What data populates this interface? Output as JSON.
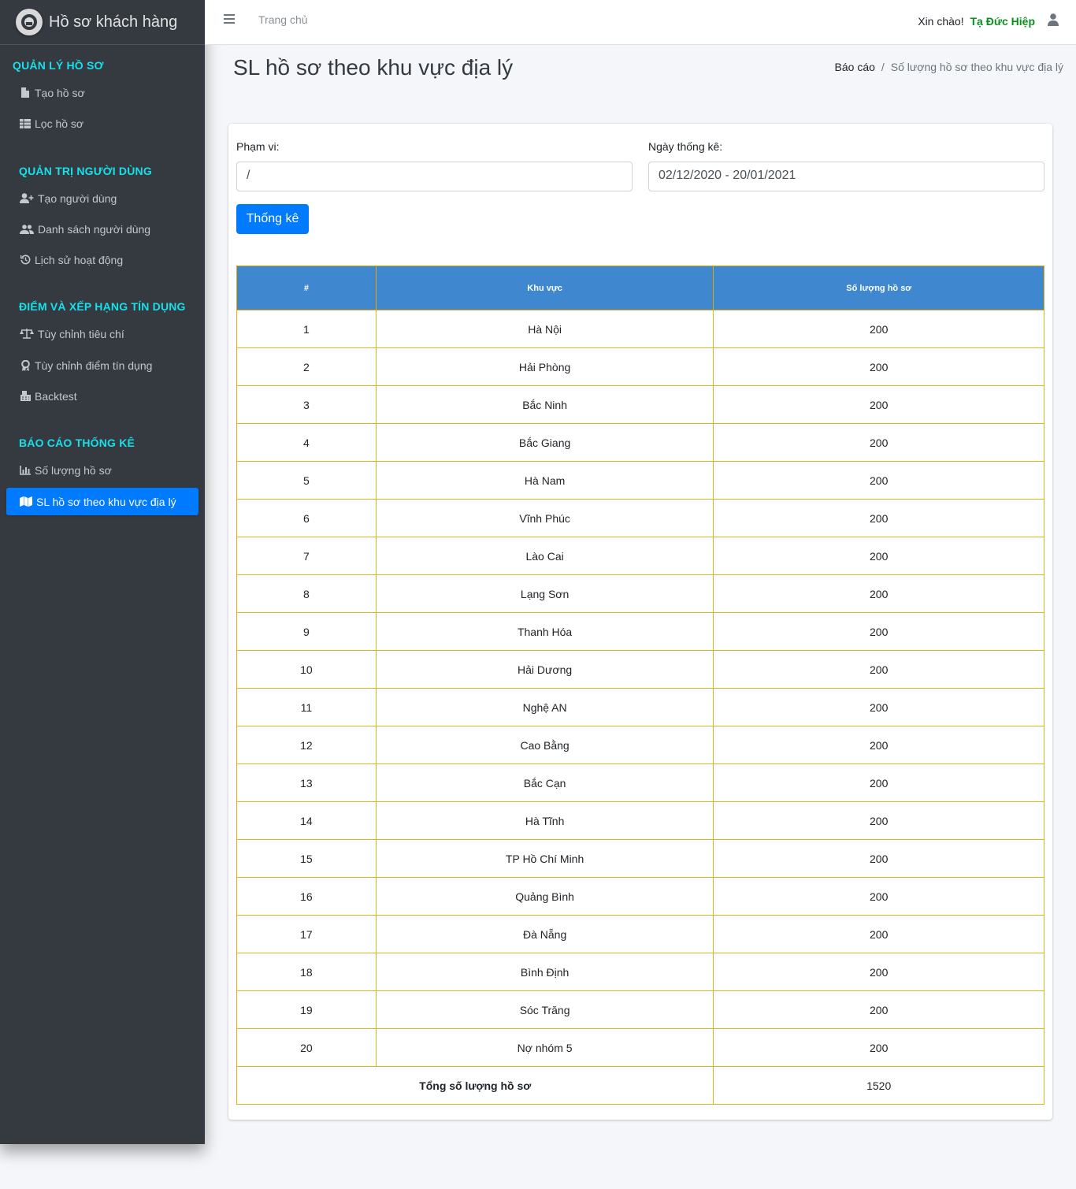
{
  "brand": {
    "title": "Hồ sơ khách hàng"
  },
  "topbar": {
    "home": "Trang chủ",
    "greeting": "Xin chào!",
    "user_name": "Tạ Đức Hiệp"
  },
  "sidebar": {
    "sections": [
      {
        "header": "QUẢN LÝ HỒ SƠ",
        "items": [
          {
            "label": "Tạo hồ sơ",
            "icon": "file-icon"
          },
          {
            "label": "Lọc hồ sơ",
            "icon": "table-icon"
          }
        ]
      },
      {
        "header": "QUẢN TRỊ NGƯỜI DÙNG",
        "items": [
          {
            "label": "Tạo người dùng",
            "icon": "user-plus-icon"
          },
          {
            "label": "Danh sách người dùng",
            "icon": "users-icon"
          },
          {
            "label": "Lịch sử hoạt động",
            "icon": "history-icon"
          }
        ]
      },
      {
        "header": "ĐIỂM VÀ XẾP HẠNG TÍN DỤNG",
        "items": [
          {
            "label": "Tùy chỉnh tiêu chí",
            "icon": "balance-scale-icon"
          },
          {
            "label": "Tùy chỉnh điểm tín dụng",
            "icon": "award-icon"
          },
          {
            "label": "Backtest",
            "icon": "calculator-icon"
          }
        ]
      },
      {
        "header": "BÁO CÁO THỐNG KÊ",
        "items": [
          {
            "label": "Số lượng hồ sơ",
            "icon": "chart-bar-icon"
          },
          {
            "label": "SL hồ sơ theo khu vực địa lý",
            "icon": "map-icon",
            "active": true
          }
        ]
      }
    ]
  },
  "page": {
    "title": "SL hồ sơ theo khu vực địa lý",
    "breadcrumb": {
      "parent": "Báo cáo",
      "separator": "/",
      "current": "Số lượng hồ sơ theo khu vực địa lý"
    }
  },
  "form": {
    "scope_label": "Phạm vi:",
    "scope_value": "/",
    "date_label": "Ngày thống kê:",
    "date_value": "02/12/2020 - 20/01/2021",
    "submit_label": "Thống kê"
  },
  "table": {
    "headers": [
      "#",
      "Khu vực",
      "Số lượng hồ sơ"
    ],
    "rows": [
      [
        "1",
        "Hà Nội",
        "200"
      ],
      [
        "2",
        "Hải Phòng",
        "200"
      ],
      [
        "3",
        "Bắc Ninh",
        "200"
      ],
      [
        "4",
        "Bắc Giang",
        "200"
      ],
      [
        "5",
        "Hà Nam",
        "200"
      ],
      [
        "6",
        "Vĩnh Phúc",
        "200"
      ],
      [
        "7",
        "Lào Cai",
        "200"
      ],
      [
        "8",
        "Lạng Sơn",
        "200"
      ],
      [
        "9",
        "Thanh Hóa",
        "200"
      ],
      [
        "10",
        "Hải Dương",
        "200"
      ],
      [
        "11",
        "Nghệ AN",
        "200"
      ],
      [
        "12",
        "Cao Bằng",
        "200"
      ],
      [
        "13",
        "Bắc Cạn",
        "200"
      ],
      [
        "14",
        "Hà Tĩnh",
        "200"
      ],
      [
        "15",
        "TP Hồ Chí Minh",
        "200"
      ],
      [
        "16",
        "Quảng Bình",
        "200"
      ],
      [
        "17",
        "Đà Nẵng",
        "200"
      ],
      [
        "18",
        "Bình Định",
        "200"
      ],
      [
        "19",
        "Sóc Trăng",
        "200"
      ],
      [
        "20",
        "Nợ nhóm 5",
        "200"
      ]
    ],
    "total_label": "Tổng số lượng hồ sơ",
    "total_value": "1520"
  },
  "colors": {
    "sidebar_bg": "#343a40",
    "accent": "#007bff",
    "section_header": "#17e0ea",
    "table_header": "#3f88d0",
    "table_border": "#e6b21c",
    "user_name": "#0a8f1e"
  }
}
